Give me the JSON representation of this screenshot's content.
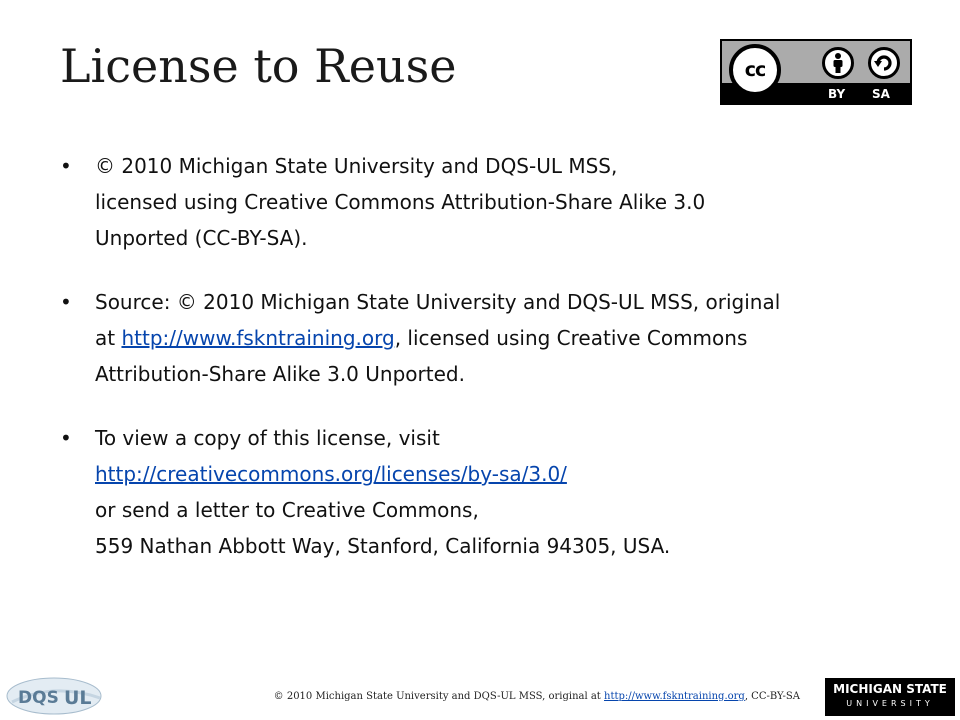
{
  "slide": {
    "title": "License to Reuse"
  },
  "badge": {
    "cc_mark": "cc",
    "by_label": "BY",
    "sa_label": "SA",
    "icons": [
      "creative-commons-icon",
      "attribution-icon",
      "share-alike-icon"
    ]
  },
  "bullets": [
    {
      "line1": "© 2010 Michigan State University and DQS-UL MSS,",
      "line2": "licensed using Creative Commons Attribution-Share Alike 3.0",
      "line3": "Unported (CC-BY-SA)."
    },
    {
      "line1": "Source: © 2010 Michigan State University and DQS-UL MSS, original",
      "line2_pre": "at ",
      "line2_link": "http://www.fskntraining.org",
      "line2_post": ", licensed using Creative Commons",
      "line3": "Attribution-Share Alike 3.0 Unported."
    },
    {
      "line1": "To view a copy of this license, visit",
      "line2_link": "http://creativecommons.org/licenses/by-sa/3.0/",
      "line3": "or send a letter to Creative Commons,",
      "line4": "559 Nathan Abbott Way, Stanford, California 94305, USA."
    }
  ],
  "footer": {
    "pre": "© 2010 Michigan State University and DQS-UL MSS, original at ",
    "link": "http://www.fskntraining.org",
    "post": ", CC-BY-SA"
  },
  "logos": {
    "dqs": {
      "mark": "DQS",
      "mark2": "UL"
    },
    "msu": {
      "line1": "MICHIGAN STATE",
      "line2": "UNIVERSITY"
    }
  },
  "colors": {
    "link": "#0645ad",
    "badge_bg": "#ababab",
    "text": "#111111"
  }
}
